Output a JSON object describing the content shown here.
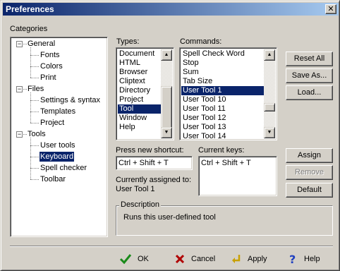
{
  "window": {
    "title": "Preferences",
    "close_glyph": "✕"
  },
  "categories": {
    "label": "Categories",
    "groups": [
      {
        "label": "General",
        "expander": "−",
        "children": [
          "Fonts",
          "Colors",
          "Print"
        ]
      },
      {
        "label": "Files",
        "expander": "−",
        "children": [
          "Settings & syntax",
          "Templates",
          "Project"
        ]
      },
      {
        "label": "Tools",
        "expander": "−",
        "children": [
          "User tools",
          "Keyboard",
          "Spell checker",
          "Toolbar"
        ]
      }
    ],
    "selected": "Keyboard"
  },
  "types": {
    "label": "Types:",
    "items": [
      "Document",
      "HTML",
      "Browser",
      "Cliptext",
      "Directory",
      "Project",
      "Tool",
      "Window",
      "Help"
    ],
    "selected": "Tool"
  },
  "commands": {
    "label": "Commands:",
    "items": [
      "Spell Check Word",
      "Stop",
      "Sum",
      "Tab Size",
      "User Tool 1",
      "User Tool 10",
      "User Tool 11",
      "User Tool 12",
      "User Tool 13",
      "User Tool 14"
    ],
    "selected": "User Tool 1"
  },
  "buttons": {
    "reset_all": "Reset All",
    "save_as": "Save As...",
    "load": "Load...",
    "assign": "Assign",
    "remove": "Remove",
    "default": "Default"
  },
  "shortcut": {
    "press_label": "Press new shortcut:",
    "press_value": "Ctrl + Shift + T",
    "current_label": "Current keys:",
    "current_value": "Ctrl + Shift + T",
    "assigned_label": "Currently assigned to:",
    "assigned_value": "User Tool 1"
  },
  "description": {
    "title": "Description",
    "text": "Runs this user-defined tool"
  },
  "footer": {
    "ok": "OK",
    "cancel": "Cancel",
    "apply": "Apply",
    "help": "Help"
  },
  "colors": {
    "titlebar": "#0a246a",
    "selection": "#0a246a",
    "face": "#d4d0c8",
    "ok_icon": "#1a8a1a",
    "cancel_icon": "#b00000",
    "apply_icon": "#c8a000",
    "help_icon": "#2040c0"
  }
}
